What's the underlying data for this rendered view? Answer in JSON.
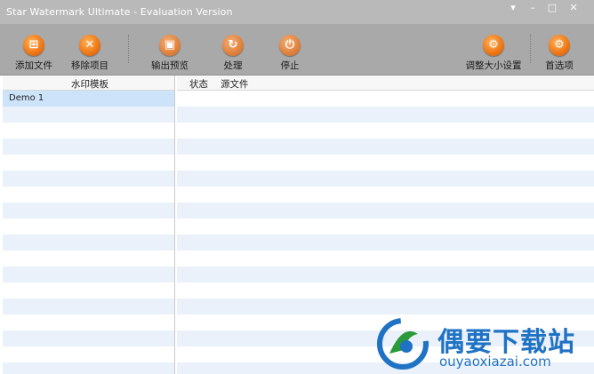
{
  "window": {
    "title": "Star Watermark Ultimate - Evaluation Version",
    "controls": [
      "▾",
      "–",
      "□",
      "✕"
    ]
  },
  "toolbar": {
    "add_files": "添加文件",
    "remove_item": "移除项目",
    "output_preview": "输出预览",
    "process": "处理",
    "stop": "停止",
    "resize_settings": "调整大小设置",
    "preferences": "首选项"
  },
  "left_panel": {
    "header": "水印模板",
    "items": [
      "Demo 1"
    ]
  },
  "right_panel": {
    "columns": [
      "状态",
      "源文件"
    ]
  },
  "watermark": {
    "name_cn": "偶要下载站",
    "url": "ouyaoxiazai.com"
  },
  "colors": {
    "titlebar": "#b9b9b9",
    "toolbar": "#a9a9a9",
    "icon_orange": "#f07a18",
    "row_alt": "#eaf1fb",
    "selected_row": "#cde3fa",
    "watermark_blue": "#1f72c4"
  }
}
